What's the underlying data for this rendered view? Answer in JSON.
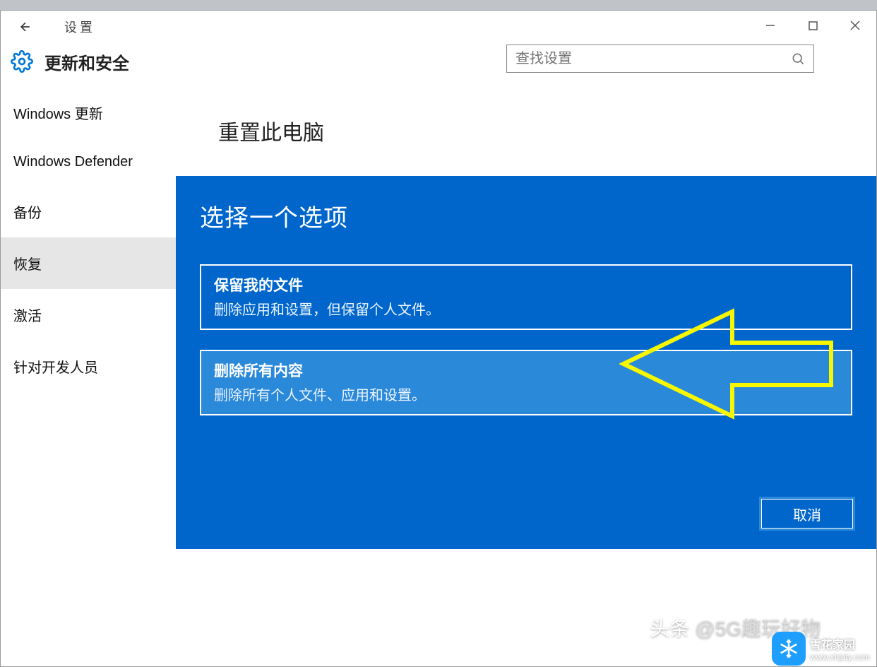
{
  "titlebar": {
    "title": "设置"
  },
  "header": {
    "section_title": "更新和安全",
    "search_placeholder": "查找设置"
  },
  "sidebar": {
    "items": [
      {
        "label": "Windows 更新"
      },
      {
        "label": "Windows Defender"
      },
      {
        "label": "备份"
      },
      {
        "label": "恢复"
      },
      {
        "label": "激活"
      },
      {
        "label": "针对开发人员"
      }
    ]
  },
  "content": {
    "heading": "重置此电脑"
  },
  "dialog": {
    "title": "选择一个选项",
    "options": [
      {
        "title": "保留我的文件",
        "desc": "删除应用和设置，但保留个人文件。"
      },
      {
        "title": "删除所有内容",
        "desc": "删除所有个人文件、应用和设置。"
      }
    ],
    "cancel_label": "取消"
  },
  "credit": {
    "prefix": "头条",
    "handle": "@5G趣玩好物"
  },
  "watermark": {
    "name": "雪花家园",
    "url": "www.xhjaty.com"
  },
  "colors": {
    "accent": "#0066cc",
    "highlight": "#2b89da",
    "arrow": "#f7f700"
  }
}
